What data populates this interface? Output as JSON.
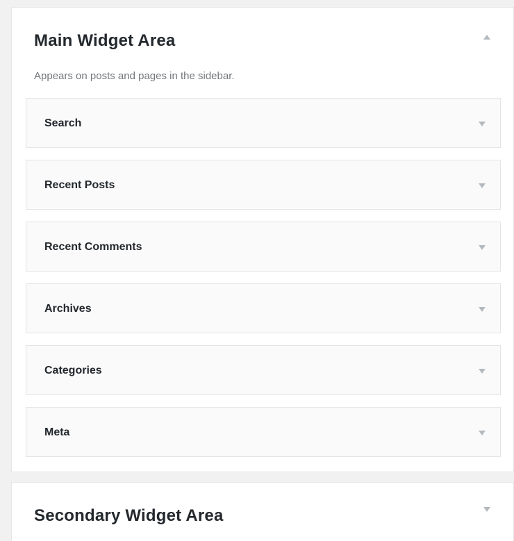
{
  "main_area": {
    "title": "Main Widget Area",
    "description": "Appears on posts and pages in the sidebar.",
    "toggle_icon": "caret-up-icon",
    "widgets": [
      {
        "label": "Search",
        "icon": "caret-down-icon"
      },
      {
        "label": "Recent Posts",
        "icon": "caret-down-icon"
      },
      {
        "label": "Recent Comments",
        "icon": "caret-down-icon"
      },
      {
        "label": "Archives",
        "icon": "caret-down-icon"
      },
      {
        "label": "Categories",
        "icon": "caret-down-icon"
      },
      {
        "label": "Meta",
        "icon": "caret-down-icon"
      }
    ]
  },
  "secondary_area": {
    "title": "Secondary Widget Area",
    "toggle_icon": "caret-down-icon"
  },
  "colors": {
    "background": "#f1f1f1",
    "panel": "#ffffff",
    "widget": "#fafafa",
    "border": "#e5e5e5",
    "title_text": "#23282d",
    "muted_text": "#72777c",
    "arrow": "#b4b9be"
  }
}
